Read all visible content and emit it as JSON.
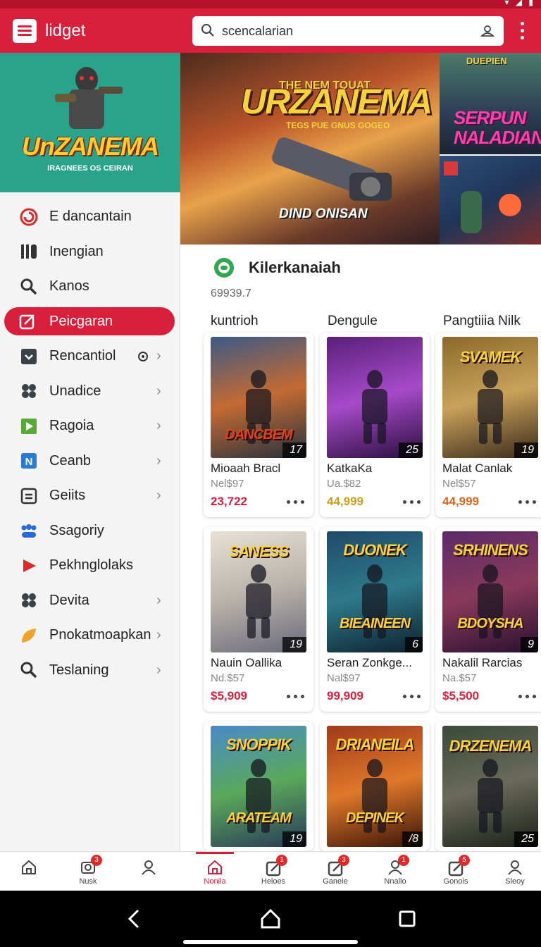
{
  "app": {
    "title": "lidget",
    "search_value": "scencalarian"
  },
  "colors": {
    "brand": "#d81f3c",
    "accent_green": "#2fa84f",
    "promo_bg": "#2aa38b"
  },
  "sidebar": {
    "promo": {
      "title": "UnZANEMA",
      "kicker": "THE NEM TOUAT",
      "subtitle": "IRAGNEES OS CEIRAN"
    },
    "items": [
      {
        "label": "E dancantain",
        "icon": "spiral-icon",
        "chevron": false,
        "active": false
      },
      {
        "label": "Inengian",
        "icon": "bars-icon",
        "chevron": false,
        "active": false
      },
      {
        "label": "Kanos",
        "icon": "search-icon",
        "chevron": false,
        "active": false
      },
      {
        "label": "Peicgaran",
        "icon": "edit-icon",
        "chevron": false,
        "active": true
      },
      {
        "label": "Rencantiol",
        "icon": "box-icon",
        "chevron": true,
        "active": false,
        "indicator": true
      },
      {
        "label": "Unadice",
        "icon": "puzzle-icon",
        "chevron": true,
        "active": false
      },
      {
        "label": "Ragoia",
        "icon": "flag-icon",
        "chevron": true,
        "active": false
      },
      {
        "label": "Ceanb",
        "icon": "tool-icon",
        "chevron": true,
        "active": false
      },
      {
        "label": "Geiits",
        "icon": "list-icon",
        "chevron": true,
        "active": false
      },
      {
        "label": "Ssagoriy",
        "icon": "group-icon",
        "chevron": false,
        "active": false
      },
      {
        "label": "Pekhnglolaks",
        "icon": "play-icon",
        "chevron": false,
        "active": false
      },
      {
        "label": "Devita",
        "icon": "puzzle-icon",
        "chevron": true,
        "active": false
      },
      {
        "label": "Pnokatmoapkan",
        "icon": "leaf-icon",
        "chevron": true,
        "active": false
      },
      {
        "label": "Teslaning",
        "icon": "search-icon",
        "chevron": true,
        "active": false
      }
    ]
  },
  "banner": {
    "main_kicker": "THE NEM TOUAT",
    "main_title": "URZANEMA",
    "main_subtitle": "TEGS PUE GNUS GOGEO",
    "main_caption": "DIND ONISAN",
    "side_kicker": "DUEPIEN",
    "side_title_1": "SERPUN",
    "side_title_2": "NALADIAN"
  },
  "section": {
    "title": "Kilerkanaiah",
    "count": "69939.7",
    "columns": [
      "kuntrioh",
      "Dengule",
      "Pangtiiia Nilk"
    ]
  },
  "cards": [
    {
      "art_title": "DANCBEM",
      "art_sub": "",
      "badge": "17",
      "name": "Mioaah Bracl",
      "price": "Nel$97",
      "value": "23,722",
      "value_color": "#d81f3c",
      "bg": [
        "#3b5a86",
        "#c46a32",
        "#26323f"
      ]
    },
    {
      "art_title": "",
      "art_sub": "",
      "badge": "25",
      "name": "KatkaKa",
      "price": "Ua.$82",
      "value": "44,999",
      "value_color": "#c9a01a",
      "bg": [
        "#5a1f7a",
        "#a64ac9",
        "#2a0f3e"
      ]
    },
    {
      "art_title": "SVAMEK",
      "art_sub": "",
      "badge": "19",
      "name": "Malat Canlak",
      "price": "Nel$57",
      "value": "44,999",
      "value_color": "#e0661a",
      "bg": [
        "#8a6a2a",
        "#c9a25a",
        "#3a2a1a"
      ]
    },
    {
      "art_title": "SANESS",
      "art_sub": "",
      "badge": "19",
      "name": "Nauin Oallika",
      "price": "Nd.$57",
      "value": "$5,909",
      "value_color": "#d81f3c",
      "bg": [
        "#e9e1d6",
        "#b9b3aa",
        "#6a6a7a"
      ]
    },
    {
      "art_title": "DUONEK",
      "art_sub": "BIEAINEEN",
      "badge": "6",
      "name": "Seran Zonkge...",
      "price": "Nal$97",
      "value": "99,909",
      "value_color": "#d81f3c",
      "bg": [
        "#1f4a6a",
        "#2e7a8a",
        "#0e1f2e"
      ]
    },
    {
      "art_title": "SRHINENS",
      "art_sub": "BDOYSHA",
      "badge": "9",
      "name": "Nakalil Rarcias",
      "price": "Na.$57",
      "value": "$5,500",
      "value_color": "#d81f3c",
      "bg": [
        "#5a2a6a",
        "#8a3a5a",
        "#2a1030"
      ]
    },
    {
      "art_title": "SNOPPIK",
      "art_sub": "ARATEAM",
      "badge": "19",
      "name": "",
      "price": "",
      "value": "",
      "value_color": "#d81f3c",
      "bg": [
        "#4a8ac9",
        "#5aa85a",
        "#2a3a5a"
      ]
    },
    {
      "art_title": "DRIANEILA",
      "art_sub": "DEPINEK",
      "badge": "/8",
      "name": "",
      "price": "",
      "value": "",
      "value_color": "#d81f3c",
      "bg": [
        "#a03a1a",
        "#e0782a",
        "#3a1408"
      ]
    },
    {
      "art_title": "DRZENEMA",
      "art_sub": "",
      "badge": "25",
      "name": "",
      "price": "",
      "value": "",
      "value_color": "#d81f3c",
      "bg": [
        "#3a4a3a",
        "#6a6a5a",
        "#1a2018"
      ]
    }
  ],
  "bottom_nav": {
    "sidebar_tabs": [
      {
        "label": "",
        "icon": "home-icon",
        "count": ""
      },
      {
        "label": "Nusk",
        "icon": "camera-icon",
        "count": "3"
      },
      {
        "label": "",
        "icon": "person-icon",
        "count": ""
      }
    ],
    "main_tabs": [
      {
        "label": "Nonila",
        "icon": "home-icon",
        "count": "",
        "active": true
      },
      {
        "label": "Heloes",
        "icon": "edit-icon",
        "count": "1",
        "active": false
      },
      {
        "label": "Ganele",
        "icon": "edit-icon",
        "count": "3",
        "active": false
      },
      {
        "label": "Nnallo",
        "icon": "person-icon",
        "count": "1",
        "active": false
      },
      {
        "label": "Gonois",
        "icon": "edit-icon",
        "count": "5",
        "active": false
      },
      {
        "label": "Sleoy",
        "icon": "person-icon",
        "count": "",
        "active": false
      }
    ]
  }
}
